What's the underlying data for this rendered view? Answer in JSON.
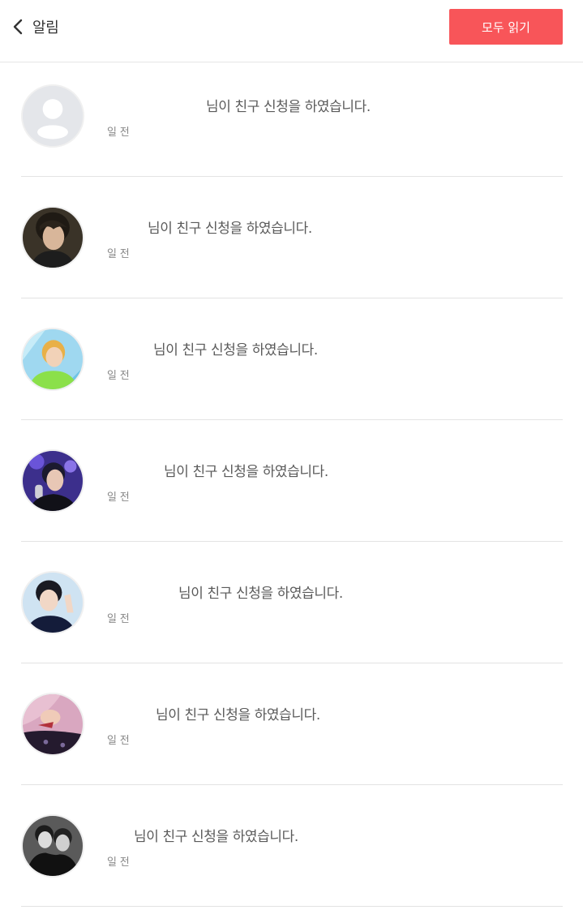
{
  "header": {
    "title": "알림",
    "read_all_label": "모두 읽기"
  },
  "colors": {
    "accent": "#f85559",
    "divider": "#e3e3e3",
    "text": "#5a5a5a",
    "subtext": "#888888"
  },
  "notifications": [
    {
      "message": "님이 친구 신청을 하였습니다.",
      "time": "일 전",
      "avatar": "default-avatar-icon"
    },
    {
      "message": "님이 친구 신청을 하였습니다.",
      "time": "일 전",
      "avatar": "user-photo"
    },
    {
      "message": "님이 친구 신청을 하였습니다.",
      "time": "일 전",
      "avatar": "user-photo"
    },
    {
      "message": "님이 친구 신청을 하였습니다.",
      "time": "일 전",
      "avatar": "user-photo"
    },
    {
      "message": "님이 친구 신청을 하였습니다.",
      "time": "일 전",
      "avatar": "user-photo"
    },
    {
      "message": "님이 친구 신청을 하였습니다.",
      "time": "일 전",
      "avatar": "user-photo"
    },
    {
      "message": "님이 친구 신청을 하였습니다.",
      "time": "일 전",
      "avatar": "user-photo"
    }
  ]
}
